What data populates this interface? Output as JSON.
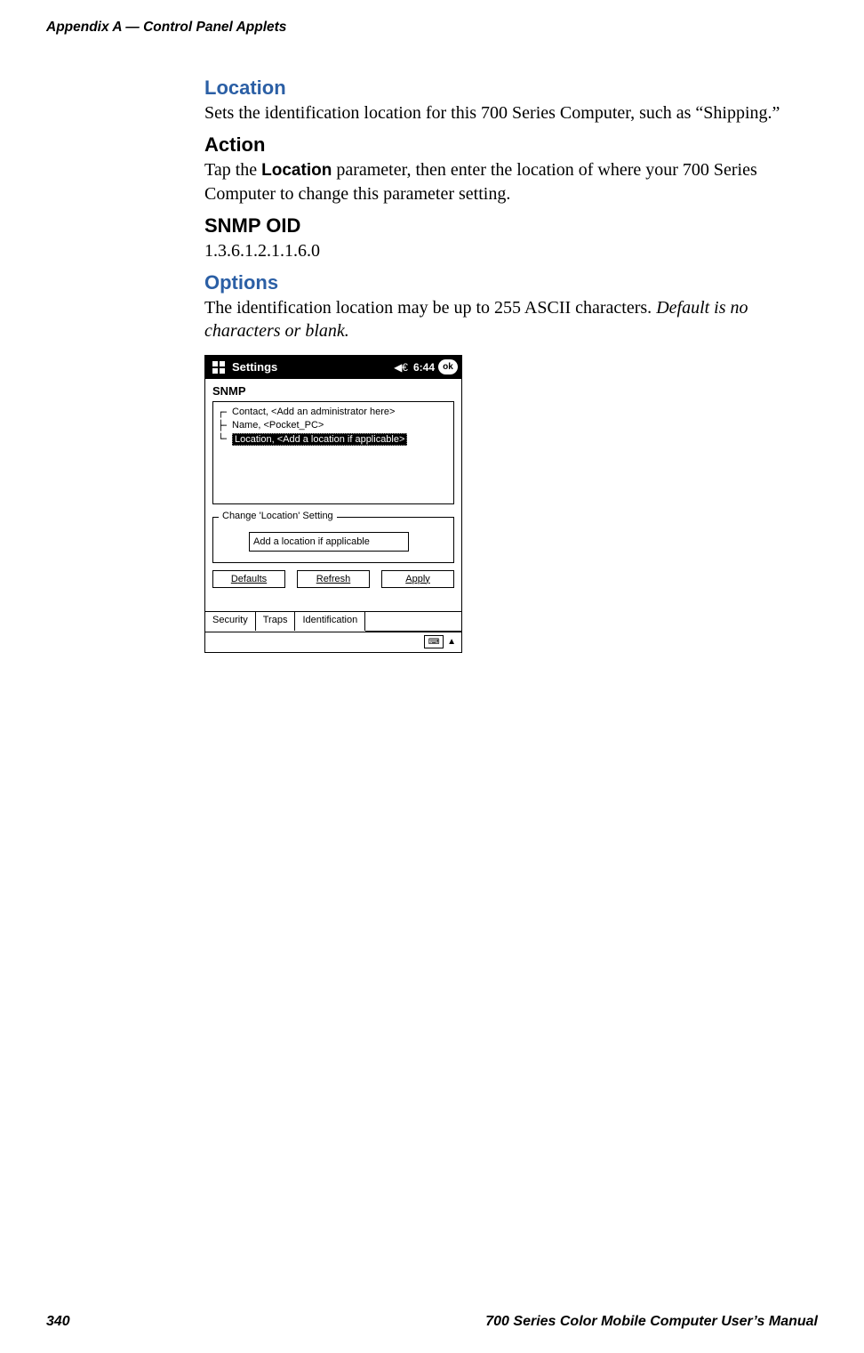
{
  "header": {
    "left": "Appendix  A    —   Control Panel Applets"
  },
  "sections": {
    "location": {
      "title": "Location",
      "text_before": "Sets the identification location for this 700 Series Computer, such as “Shipping.”"
    },
    "action": {
      "title": "Action",
      "text_prefix": "Tap the ",
      "bold_word": "Location",
      "text_suffix": " parameter, then enter the location of where your 700 Series Computer to change this parameter setting."
    },
    "snmp_oid": {
      "title": "SNMP OID",
      "value": "1.3.6.1.2.1.1.6.0"
    },
    "options": {
      "title": "Options",
      "text_plain": "The identification location may be up to 255 ASCII characters. ",
      "text_italic": "Default is no characters or blank."
    }
  },
  "device": {
    "titlebar": {
      "title": "Settings",
      "time": "6:44",
      "ok": "ok"
    },
    "app_title": "SNMP",
    "tree": [
      {
        "label": "Contact, <Add an administrator here>",
        "selected": false
      },
      {
        "label": "Name, <Pocket_PC>",
        "selected": false
      },
      {
        "label": "Location, <Add a location if applicable>",
        "selected": true
      }
    ],
    "group": {
      "legend": "Change 'Location' Setting",
      "input_value": "Add a location if applicable"
    },
    "buttons": {
      "defaults": "Defaults",
      "refresh": "Refresh",
      "apply": "Apply"
    },
    "tabs": [
      "Security",
      "Traps",
      "Identification"
    ]
  },
  "footer": {
    "page": "340",
    "manual": "700 Series Color Mobile Computer User’s Manual"
  }
}
